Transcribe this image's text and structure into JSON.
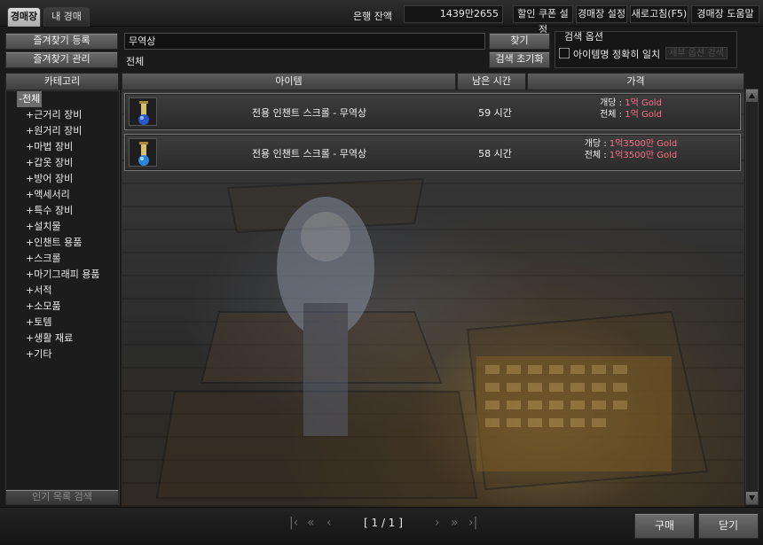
{
  "tabs": [
    {
      "label": "경매장",
      "active": true
    },
    {
      "label": "내 경매",
      "active": false
    }
  ],
  "topbar": {
    "bank_label": "은행 잔액",
    "bank_amount": "1439만2655",
    "links": [
      "할인 쿠폰 설정",
      "경매장 설정",
      "새로고침(F5)",
      "경매장 도움말"
    ]
  },
  "left_buttons": {
    "register_favorite": "즐겨찾기 등록",
    "manage_favorite": "즐겨찾기 관리"
  },
  "search": {
    "value": "무역상",
    "category_label": "전체",
    "find_button": "찾기",
    "reset_button": "검색 초기화",
    "options_title": "검색 옵션",
    "exact_match_label": "아이템명 정확히 일치",
    "exact_match_checked": false,
    "disabled_button": "세부 옵션 검색"
  },
  "category_panel": {
    "header": "카테고리",
    "items": [
      "-전체",
      "+근거리 장비",
      "+원거리 장비",
      "+마법 장비",
      "+갑옷 장비",
      "+방어 장비",
      "+액세서리",
      "+특수 장비",
      "+설치물",
      "+인챈트 용품",
      "+스크롤",
      "+마기그래피 용품",
      "+서적",
      "+소모품",
      "+토템",
      "+생활 재료",
      "+기타"
    ],
    "popular_search_button": "인기 목록 검색"
  },
  "columns": {
    "item": "아이템",
    "time_left": "남은 시간",
    "price": "가격"
  },
  "listings": [
    {
      "name": "전용 인챈트 스크롤 - 무역상",
      "time_left": "59 시간",
      "unit_label": "개당 :",
      "unit_price": "1억 Gold",
      "total_label": "전체 :",
      "total_price": "1억 Gold"
    },
    {
      "name": "전용 인챈트 스크롤 - 무역상",
      "time_left": "58 시간",
      "unit_label": "개당 :",
      "unit_price": "1억3500만 Gold",
      "total_label": "전체 :",
      "total_price": "1억3500만 Gold"
    }
  ],
  "pagination": {
    "text": "[ 1 / 1 ]"
  },
  "bottom_buttons": {
    "buy": "구매",
    "close": "닫기"
  },
  "colors": {
    "price_highlight": "#ff6e8a",
    "active_tab": "#c8c8c8"
  }
}
